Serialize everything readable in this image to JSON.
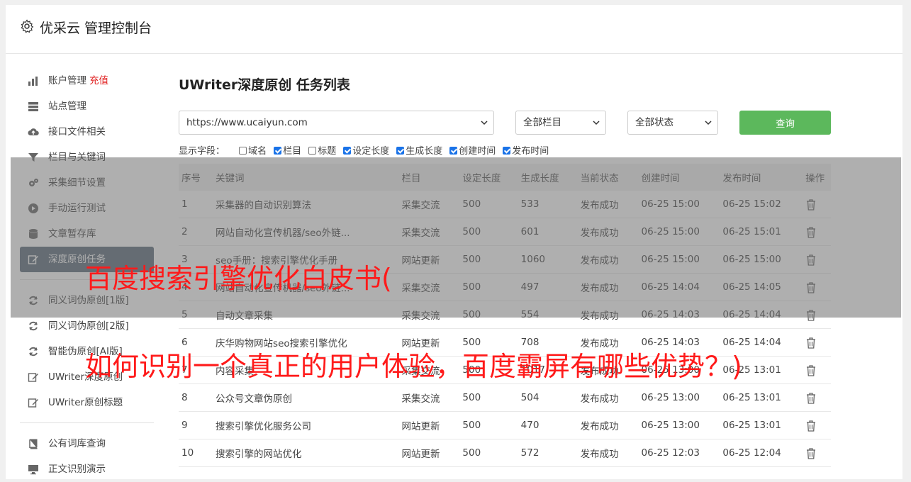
{
  "header": {
    "title": "优采云 管理控制台"
  },
  "sidebar": {
    "group1": [
      {
        "label": "账户管理",
        "extra": "充值",
        "icon": "bar-chart-icon"
      },
      {
        "label": "站点管理",
        "icon": "server-icon"
      },
      {
        "label": "接口文件相关",
        "icon": "cloud-upload-icon"
      },
      {
        "label": "栏目与关键词",
        "icon": "filter-icon"
      },
      {
        "label": "采集细节设置",
        "icon": "gears-icon"
      },
      {
        "label": "手动运行测试",
        "icon": "play-circle-icon"
      },
      {
        "label": "文章暂存库",
        "icon": "database-icon"
      },
      {
        "label": "深度原创任务",
        "icon": "edit-icon",
        "active": true
      }
    ],
    "group2": [
      {
        "label": "同义词伪原创[1版]",
        "icon": "refresh-icon"
      },
      {
        "label": "同义词伪原创[2版]",
        "icon": "refresh-icon"
      },
      {
        "label": "智能伪原创[AI版]",
        "icon": "refresh-icon"
      },
      {
        "label": "UWriter深度原创",
        "icon": "edit-icon"
      },
      {
        "label": "UWriter原创标题",
        "icon": "edit-icon"
      }
    ],
    "group3": [
      {
        "label": "公有词库查询",
        "icon": "book-icon"
      },
      {
        "label": "正文识别演示",
        "icon": "monitor-icon"
      }
    ]
  },
  "main": {
    "title": "UWriter深度原创 任务列表",
    "site_select": "https://www.ucaiyun.com",
    "column_select": "全部栏目",
    "status_select": "全部状态",
    "query_label": "查询",
    "fields_label": "显示字段：",
    "fields": [
      {
        "label": "域名",
        "checked": false
      },
      {
        "label": "栏目",
        "checked": true
      },
      {
        "label": "标题",
        "checked": false
      },
      {
        "label": "设定长度",
        "checked": true
      },
      {
        "label": "生成长度",
        "checked": true
      },
      {
        "label": "创建时间",
        "checked": true
      },
      {
        "label": "发布时间",
        "checked": true
      }
    ],
    "columns": [
      "序号",
      "关键词",
      "栏目",
      "设定长度",
      "生成长度",
      "当前状态",
      "创建时间",
      "发布时间",
      "操作"
    ],
    "rows": [
      [
        "1",
        "采集器的自动识别算法",
        "采集交流",
        "500",
        "533",
        "发布成功",
        "06-25 15:00",
        "06-25 15:02"
      ],
      [
        "2",
        "网站自动化宣传机器/seo外链...",
        "采集交流",
        "500",
        "601",
        "发布成功",
        "06-25 15:00",
        "06-25 15:01"
      ],
      [
        "3",
        "seo手册：搜索引擎优化手册",
        "网站更新",
        "500",
        "1060",
        "发布成功",
        "06-25 15:00",
        "06-25 15:00"
      ],
      [
        "4",
        "网站自动化宣传机器/seo外链...",
        "采集交流",
        "500",
        "497",
        "发布成功",
        "06-25 14:04",
        "06-25 14:05"
      ],
      [
        "5",
        "自动文章采集",
        "采集交流",
        "500",
        "554",
        "发布成功",
        "06-25 14:03",
        "06-25 14:04"
      ],
      [
        "6",
        "庆华购物网站seo搜索引擎优化",
        "网站更新",
        "500",
        "708",
        "发布成功",
        "06-25 14:03",
        "06-25 14:04"
      ],
      [
        "7",
        "内容采集",
        "采集交流",
        "500",
        "1017",
        "发布成功",
        "06-25 13:00",
        "06-25 13:01"
      ],
      [
        "8",
        "公众号文章伪原创",
        "采集交流",
        "500",
        "504",
        "发布成功",
        "06-25 13:00",
        "06-25 13:01"
      ],
      [
        "9",
        "搜索引擎优化服务公司",
        "网站更新",
        "500",
        "470",
        "发布成功",
        "06-25 13:00",
        "06-25 13:01"
      ],
      [
        "10",
        "搜索引擎的网站优化",
        "网站更新",
        "500",
        "572",
        "发布成功",
        "06-25 12:03",
        "06-25 12:04"
      ]
    ]
  },
  "overlay": {
    "line1": "百度搜索引擎优化白皮书(",
    "line2": "如何识别一个真正的用户体验，百度霸屏有哪些优势？)"
  },
  "colors": {
    "accent_green": "#5cb85c",
    "sidebar_active": "#5c6b7a",
    "banner_red": "#ff1a1a",
    "status_green": "#2f9a2f"
  }
}
